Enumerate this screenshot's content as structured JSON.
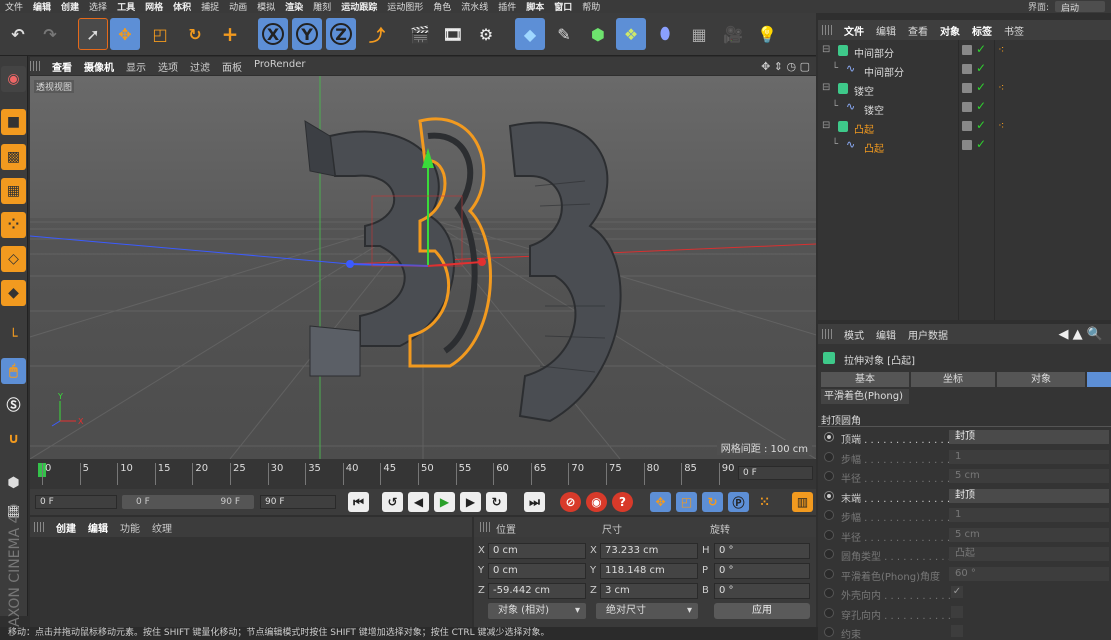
{
  "menubar": {
    "items": [
      "文件",
      "编辑",
      "创建",
      "选择",
      "工具",
      "网格",
      "体积",
      "捕捉",
      "动画",
      "模拟",
      "渲染",
      "雕刻",
      "运动跟踪",
      "运动图形",
      "角色",
      "流水线",
      "插件",
      "脚本",
      "窗口",
      "帮助"
    ],
    "bold": [
      false,
      true,
      true,
      false,
      true,
      true,
      true,
      false,
      false,
      false,
      true,
      false,
      true,
      false,
      false,
      false,
      false,
      true,
      true,
      false
    ],
    "layout_label": "界面:",
    "layout_value": "启动"
  },
  "toolbar": {
    "icons": [
      "undo-icon",
      "redo-icon",
      "select-arrow-icon",
      "move-icon",
      "scale-icon",
      "rotate-icon",
      "add-icon",
      "x-axis-icon",
      "y-axis-icon",
      "z-axis-icon",
      "coordinate-system-icon",
      "render-view-icon",
      "render-picture-viewer-icon",
      "render-settings-icon",
      "cube-icon",
      "pen-icon",
      "subdivision-icon",
      "array-icon",
      "deformer-icon",
      "floor-icon",
      "camera-icon",
      "light-icon"
    ],
    "axis_labels": [
      "X",
      "Y",
      "Z"
    ]
  },
  "left_tools": [
    "make-editable-icon",
    "model-mode-icon",
    "texture-mode-icon",
    "workplane-icon",
    "points-mode-icon",
    "edges-mode-icon",
    "polygons-mode-icon",
    "axis-mode-icon",
    "tweak-icon",
    "snap-icon",
    "solo-icon",
    "magnet-icon",
    "lock-icon",
    "grid-icon"
  ],
  "viewport_menu": {
    "items": [
      "查看",
      "摄像机",
      "显示",
      "选项",
      "过滤",
      "面板",
      "ProRender"
    ],
    "bold": [
      true,
      true,
      false,
      false,
      false,
      false,
      false
    ]
  },
  "viewport": {
    "view_name": "透视视图",
    "grid_spacing": "网格间距 : 100 cm",
    "axis_y": "Y",
    "axis_x": "X"
  },
  "timeline": {
    "ticks": [
      "0",
      "5",
      "10",
      "15",
      "20",
      "25",
      "30",
      "35",
      "40",
      "45",
      "50",
      "55",
      "60",
      "65",
      "70",
      "75",
      "80",
      "85",
      "90"
    ],
    "current_frame": "0 F"
  },
  "playback": {
    "start": "0 F",
    "range_start": "0 F",
    "range_end": "90 F",
    "end": "90 F"
  },
  "material_manager": {
    "menu": [
      "创建",
      "编辑",
      "功能",
      "纹理"
    ],
    "bold": [
      true,
      true,
      false,
      false
    ]
  },
  "coordinates": {
    "headers": {
      "position": "位置",
      "size": "尺寸",
      "rotation": "旋转"
    },
    "rows": [
      {
        "axis": "X",
        "pos": "0 cm",
        "size_axis": "X",
        "size": "73.233 cm",
        "rot_axis": "H",
        "rot": "0 °"
      },
      {
        "axis": "Y",
        "pos": "0 cm",
        "size_axis": "Y",
        "size": "118.148 cm",
        "rot_axis": "P",
        "rot": "0 °"
      },
      {
        "axis": "Z",
        "pos": "-59.442 cm",
        "size_axis": "Z",
        "size": "3 cm",
        "rot_axis": "B",
        "rot": "0 °"
      }
    ],
    "mode_select": "对象 (相对)",
    "size_select": "绝对尺寸",
    "apply": "应用"
  },
  "object_manager": {
    "menu": [
      "文件",
      "编辑",
      "查看",
      "对象",
      "标签",
      "书签"
    ],
    "bold": [
      true,
      false,
      false,
      true,
      true,
      false
    ],
    "rows": [
      {
        "name": "中间部分",
        "level": 0,
        "type": "extrude",
        "selected": false,
        "tag": true
      },
      {
        "name": "中间部分",
        "level": 1,
        "type": "spline",
        "selected": false,
        "tag": false
      },
      {
        "name": "镂空",
        "level": 0,
        "type": "extrude",
        "selected": false,
        "tag": true
      },
      {
        "name": "镂空",
        "level": 1,
        "type": "spline",
        "selected": false,
        "tag": false
      },
      {
        "name": "凸起",
        "level": 0,
        "type": "extrude",
        "selected": true,
        "tag": true
      },
      {
        "name": "凸起",
        "level": 1,
        "type": "spline",
        "selected": true,
        "tag": false
      }
    ]
  },
  "attributes": {
    "menu": [
      "模式",
      "编辑",
      "用户数据"
    ],
    "object_title": "拉伸对象 [凸起]",
    "tabs": [
      "基本",
      "坐标",
      "对象"
    ],
    "phong_tab": "平滑着色(Phong)",
    "section": "封顶圆角",
    "rows": [
      {
        "label": "顶端 . . . . . . . . . . . . . .",
        "value": "封顶",
        "radio": true,
        "dim": false,
        "sub": false
      },
      {
        "label": "步幅 . . . . . . . . . . . . . .",
        "value": "1",
        "radio": false,
        "dim": true,
        "sub": true
      },
      {
        "label": "半径 . . . . . . . . . . . . . .",
        "value": "5 cm",
        "radio": false,
        "dim": true,
        "sub": true
      },
      {
        "label": "末端 . . . . . . . . . . . . . .",
        "value": "封顶",
        "radio": true,
        "dim": false,
        "sub": false
      },
      {
        "label": "步幅 . . . . . . . . . . . . . .",
        "value": "1",
        "radio": false,
        "dim": true,
        "sub": true
      },
      {
        "label": "半径 . . . . . . . . . . . . . .",
        "value": "5 cm",
        "radio": false,
        "dim": true,
        "sub": true
      },
      {
        "label": "圆角类型 . . . . . . . . . . .",
        "value": "凸起",
        "radio": false,
        "dim": true,
        "sub": true
      },
      {
        "label": "平滑着色(Phong)角度",
        "value": "60 °",
        "radio": false,
        "dim": true,
        "sub": true
      },
      {
        "label": "外壳向内 . . . . . . . . . . .",
        "value": "✓",
        "radio": false,
        "dim": true,
        "sub": true
      },
      {
        "label": "穿孔向内 . . . . . . . . . . .",
        "value": "",
        "radio": false,
        "dim": true,
        "sub": true
      },
      {
        "label": "约束",
        "value": "",
        "radio": false,
        "dim": true,
        "sub": true
      }
    ]
  },
  "statusbar": "移动：点击并拖动鼠标移动元素。按住 SHIFT 键量化移动；节点编辑模式时按住 SHIFT 键增加选择对象；按住 CTRL 键减少选择对象。",
  "branding": "MAXON CINEMA 4D",
  "colors": {
    "accent_orange": "#f29a1f",
    "select_blue": "#5d8fd6",
    "bg": "#2f2f2f"
  }
}
